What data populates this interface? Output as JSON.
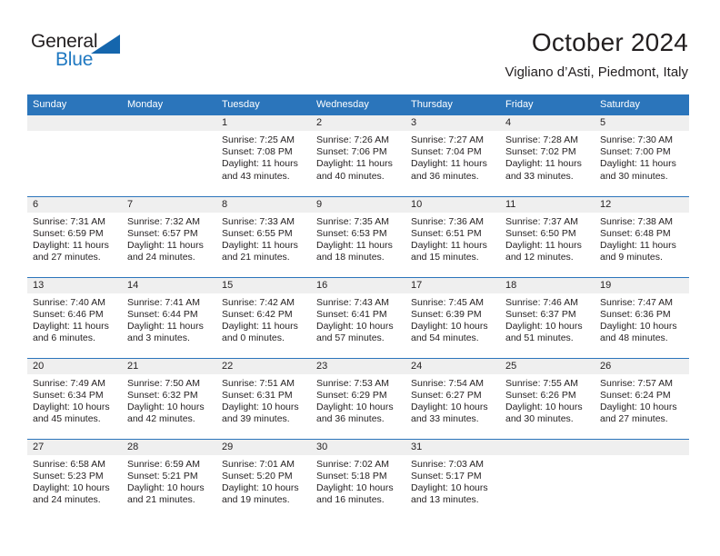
{
  "brand": {
    "name_part1": "General",
    "name_part2": "Blue",
    "triangle_color": "#1566ad",
    "accent_color": "#1f78c1"
  },
  "header": {
    "title": "October 2024",
    "subtitle": "Vigliano d’Asti, Piedmont, Italy",
    "header_bg": "#2b75bb",
    "date_band_bg": "#efefef"
  },
  "weekday_headers": [
    "Sunday",
    "Monday",
    "Tuesday",
    "Wednesday",
    "Thursday",
    "Friday",
    "Saturday"
  ],
  "weeks": [
    [
      {
        "date": "",
        "empty": true,
        "sunrise": "",
        "sunset": "",
        "daylight_line1": "",
        "daylight_line2": ""
      },
      {
        "date": "",
        "empty": true,
        "sunrise": "",
        "sunset": "",
        "daylight_line1": "",
        "daylight_line2": ""
      },
      {
        "date": "1",
        "empty": false,
        "sunrise": "Sunrise: 7:25 AM",
        "sunset": "Sunset: 7:08 PM",
        "daylight_line1": "Daylight: 11 hours",
        "daylight_line2": "and 43 minutes."
      },
      {
        "date": "2",
        "empty": false,
        "sunrise": "Sunrise: 7:26 AM",
        "sunset": "Sunset: 7:06 PM",
        "daylight_line1": "Daylight: 11 hours",
        "daylight_line2": "and 40 minutes."
      },
      {
        "date": "3",
        "empty": false,
        "sunrise": "Sunrise: 7:27 AM",
        "sunset": "Sunset: 7:04 PM",
        "daylight_line1": "Daylight: 11 hours",
        "daylight_line2": "and 36 minutes."
      },
      {
        "date": "4",
        "empty": false,
        "sunrise": "Sunrise: 7:28 AM",
        "sunset": "Sunset: 7:02 PM",
        "daylight_line1": "Daylight: 11 hours",
        "daylight_line2": "and 33 minutes."
      },
      {
        "date": "5",
        "empty": false,
        "sunrise": "Sunrise: 7:30 AM",
        "sunset": "Sunset: 7:00 PM",
        "daylight_line1": "Daylight: 11 hours",
        "daylight_line2": "and 30 minutes."
      }
    ],
    [
      {
        "date": "6",
        "empty": false,
        "sunrise": "Sunrise: 7:31 AM",
        "sunset": "Sunset: 6:59 PM",
        "daylight_line1": "Daylight: 11 hours",
        "daylight_line2": "and 27 minutes."
      },
      {
        "date": "7",
        "empty": false,
        "sunrise": "Sunrise: 7:32 AM",
        "sunset": "Sunset: 6:57 PM",
        "daylight_line1": "Daylight: 11 hours",
        "daylight_line2": "and 24 minutes."
      },
      {
        "date": "8",
        "empty": false,
        "sunrise": "Sunrise: 7:33 AM",
        "sunset": "Sunset: 6:55 PM",
        "daylight_line1": "Daylight: 11 hours",
        "daylight_line2": "and 21 minutes."
      },
      {
        "date": "9",
        "empty": false,
        "sunrise": "Sunrise: 7:35 AM",
        "sunset": "Sunset: 6:53 PM",
        "daylight_line1": "Daylight: 11 hours",
        "daylight_line2": "and 18 minutes."
      },
      {
        "date": "10",
        "empty": false,
        "sunrise": "Sunrise: 7:36 AM",
        "sunset": "Sunset: 6:51 PM",
        "daylight_line1": "Daylight: 11 hours",
        "daylight_line2": "and 15 minutes."
      },
      {
        "date": "11",
        "empty": false,
        "sunrise": "Sunrise: 7:37 AM",
        "sunset": "Sunset: 6:50 PM",
        "daylight_line1": "Daylight: 11 hours",
        "daylight_line2": "and 12 minutes."
      },
      {
        "date": "12",
        "empty": false,
        "sunrise": "Sunrise: 7:38 AM",
        "sunset": "Sunset: 6:48 PM",
        "daylight_line1": "Daylight: 11 hours",
        "daylight_line2": "and 9 minutes."
      }
    ],
    [
      {
        "date": "13",
        "empty": false,
        "sunrise": "Sunrise: 7:40 AM",
        "sunset": "Sunset: 6:46 PM",
        "daylight_line1": "Daylight: 11 hours",
        "daylight_line2": "and 6 minutes."
      },
      {
        "date": "14",
        "empty": false,
        "sunrise": "Sunrise: 7:41 AM",
        "sunset": "Sunset: 6:44 PM",
        "daylight_line1": "Daylight: 11 hours",
        "daylight_line2": "and 3 minutes."
      },
      {
        "date": "15",
        "empty": false,
        "sunrise": "Sunrise: 7:42 AM",
        "sunset": "Sunset: 6:42 PM",
        "daylight_line1": "Daylight: 11 hours",
        "daylight_line2": "and 0 minutes."
      },
      {
        "date": "16",
        "empty": false,
        "sunrise": "Sunrise: 7:43 AM",
        "sunset": "Sunset: 6:41 PM",
        "daylight_line1": "Daylight: 10 hours",
        "daylight_line2": "and 57 minutes."
      },
      {
        "date": "17",
        "empty": false,
        "sunrise": "Sunrise: 7:45 AM",
        "sunset": "Sunset: 6:39 PM",
        "daylight_line1": "Daylight: 10 hours",
        "daylight_line2": "and 54 minutes."
      },
      {
        "date": "18",
        "empty": false,
        "sunrise": "Sunrise: 7:46 AM",
        "sunset": "Sunset: 6:37 PM",
        "daylight_line1": "Daylight: 10 hours",
        "daylight_line2": "and 51 minutes."
      },
      {
        "date": "19",
        "empty": false,
        "sunrise": "Sunrise: 7:47 AM",
        "sunset": "Sunset: 6:36 PM",
        "daylight_line1": "Daylight: 10 hours",
        "daylight_line2": "and 48 minutes."
      }
    ],
    [
      {
        "date": "20",
        "empty": false,
        "sunrise": "Sunrise: 7:49 AM",
        "sunset": "Sunset: 6:34 PM",
        "daylight_line1": "Daylight: 10 hours",
        "daylight_line2": "and 45 minutes."
      },
      {
        "date": "21",
        "empty": false,
        "sunrise": "Sunrise: 7:50 AM",
        "sunset": "Sunset: 6:32 PM",
        "daylight_line1": "Daylight: 10 hours",
        "daylight_line2": "and 42 minutes."
      },
      {
        "date": "22",
        "empty": false,
        "sunrise": "Sunrise: 7:51 AM",
        "sunset": "Sunset: 6:31 PM",
        "daylight_line1": "Daylight: 10 hours",
        "daylight_line2": "and 39 minutes."
      },
      {
        "date": "23",
        "empty": false,
        "sunrise": "Sunrise: 7:53 AM",
        "sunset": "Sunset: 6:29 PM",
        "daylight_line1": "Daylight: 10 hours",
        "daylight_line2": "and 36 minutes."
      },
      {
        "date": "24",
        "empty": false,
        "sunrise": "Sunrise: 7:54 AM",
        "sunset": "Sunset: 6:27 PM",
        "daylight_line1": "Daylight: 10 hours",
        "daylight_line2": "and 33 minutes."
      },
      {
        "date": "25",
        "empty": false,
        "sunrise": "Sunrise: 7:55 AM",
        "sunset": "Sunset: 6:26 PM",
        "daylight_line1": "Daylight: 10 hours",
        "daylight_line2": "and 30 minutes."
      },
      {
        "date": "26",
        "empty": false,
        "sunrise": "Sunrise: 7:57 AM",
        "sunset": "Sunset: 6:24 PM",
        "daylight_line1": "Daylight: 10 hours",
        "daylight_line2": "and 27 minutes."
      }
    ],
    [
      {
        "date": "27",
        "empty": false,
        "sunrise": "Sunrise: 6:58 AM",
        "sunset": "Sunset: 5:23 PM",
        "daylight_line1": "Daylight: 10 hours",
        "daylight_line2": "and 24 minutes."
      },
      {
        "date": "28",
        "empty": false,
        "sunrise": "Sunrise: 6:59 AM",
        "sunset": "Sunset: 5:21 PM",
        "daylight_line1": "Daylight: 10 hours",
        "daylight_line2": "and 21 minutes."
      },
      {
        "date": "29",
        "empty": false,
        "sunrise": "Sunrise: 7:01 AM",
        "sunset": "Sunset: 5:20 PM",
        "daylight_line1": "Daylight: 10 hours",
        "daylight_line2": "and 19 minutes."
      },
      {
        "date": "30",
        "empty": false,
        "sunrise": "Sunrise: 7:02 AM",
        "sunset": "Sunset: 5:18 PM",
        "daylight_line1": "Daylight: 10 hours",
        "daylight_line2": "and 16 minutes."
      },
      {
        "date": "31",
        "empty": false,
        "sunrise": "Sunrise: 7:03 AM",
        "sunset": "Sunset: 5:17 PM",
        "daylight_line1": "Daylight: 10 hours",
        "daylight_line2": "and 13 minutes."
      },
      {
        "date": "",
        "empty": true,
        "sunrise": "",
        "sunset": "",
        "daylight_line1": "",
        "daylight_line2": ""
      },
      {
        "date": "",
        "empty": true,
        "sunrise": "",
        "sunset": "",
        "daylight_line1": "",
        "daylight_line2": ""
      }
    ]
  ]
}
